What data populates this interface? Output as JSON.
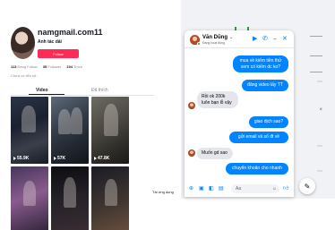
{
  "profile": {
    "username": "namgmail.com11",
    "subtitle": "Anh tác dải",
    "follow_label": "Follow",
    "stats": [
      {
        "value": "113",
        "label": "Đang Follow"
      },
      {
        "value": "35",
        "label": "Follower"
      },
      {
        "value": "194",
        "label": "Thích"
      }
    ],
    "bio": "Chưa có tiểu sử.",
    "tabs": [
      "Video",
      "Đã thích"
    ],
    "videos": [
      {
        "views": "55.9K",
        "caption": ""
      },
      {
        "views": "57K",
        "caption": ""
      },
      {
        "views": "47.8K",
        "caption": ""
      },
      {
        "views": "",
        "caption": ""
      },
      {
        "views": "",
        "caption": ""
      },
      {
        "views": "",
        "caption": ""
      }
    ],
    "report_label": "Tải ứng dụng"
  },
  "chat": {
    "contact_name": "Văn Dũng",
    "contact_status": "Đang hoạt động",
    "header_icons": [
      "video-call-icon",
      "phone-icon",
      "minimize-icon",
      "close-icon"
    ],
    "messages": [
      {
        "direction": "out",
        "text": "mua về kiếm tiền thử xem có kiếm dc ko?"
      },
      {
        "direction": "out",
        "text": "đăng video lấy TT"
      },
      {
        "direction": "in",
        "text": "Rồi ok 200k luôn bạn lỗ vậy"
      },
      {
        "direction": "out",
        "text": "giao dịch sao?"
      },
      {
        "direction": "out",
        "text": "gửi email và số đt về"
      },
      {
        "direction": "in",
        "text": "Muốn gd sao"
      },
      {
        "direction": "out",
        "text": "chuyển khoản cho nhanh"
      }
    ],
    "composer_placeholder": "Aa",
    "accent": "#0084ff"
  },
  "colors": {
    "follow": "#fe2c55",
    "online": "#31a24c"
  }
}
